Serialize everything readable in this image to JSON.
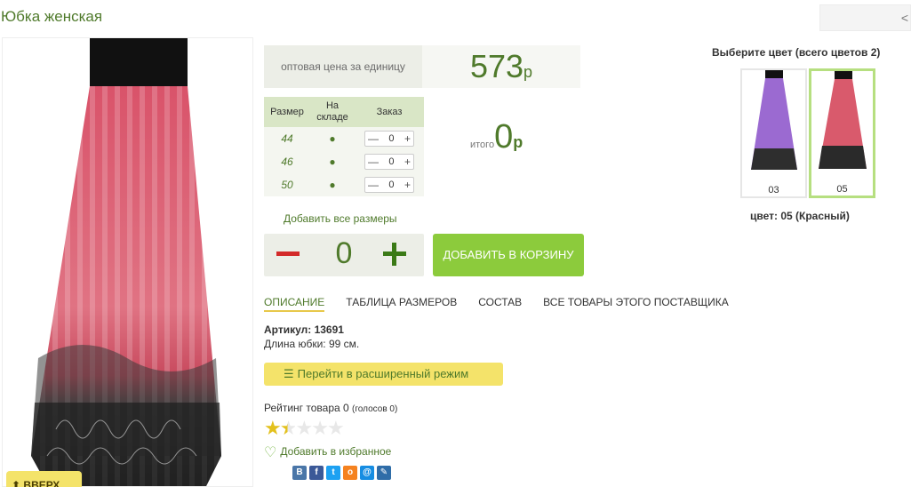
{
  "product": {
    "title": "Юбка женская",
    "up_button": "ВВЕРХ"
  },
  "nav": {
    "arrow": "<"
  },
  "price": {
    "label": "оптовая цена за единицу",
    "value": "573",
    "currency": "р"
  },
  "size_table": {
    "headers": [
      "Размер",
      "На складе",
      "Заказ"
    ],
    "rows": [
      {
        "size": "44",
        "stock": "●",
        "qty": "0"
      },
      {
        "size": "46",
        "stock": "●",
        "qty": "0"
      },
      {
        "size": "50",
        "stock": "●",
        "qty": "0"
      }
    ],
    "minus": "—",
    "plus": "+"
  },
  "total": {
    "label": "итого",
    "value": "0",
    "currency": "р"
  },
  "add_all_sizes": "Добавить все размеры",
  "big_stepper": {
    "value": "0"
  },
  "cart_button": "ДОБАВИТЬ В КОРЗИНУ",
  "tabs": [
    {
      "label": "ОПИСАНИЕ",
      "active": true
    },
    {
      "label": "ТАБЛИЦА РАЗМЕРОВ",
      "active": false
    },
    {
      "label": "СОСТАВ",
      "active": false
    },
    {
      "label": "ВСЕ ТОВАРЫ ЭТОГО ПОСТАВЩИКА",
      "active": false
    }
  ],
  "description": {
    "article": "Артикул: 13691",
    "length": "Длина юбки: 99 см."
  },
  "advanced_mode_button": "Перейти в расширенный режим",
  "rating": {
    "label": "Рейтинг товара 0",
    "votes": "(голосов 0)",
    "stars": 1.5,
    "max": 5
  },
  "favorite": "Добавить в избранное",
  "social": [
    {
      "name": "vk-icon",
      "glyph": "В",
      "color": "#4a76a8"
    },
    {
      "name": "facebook-icon",
      "glyph": "f",
      "color": "#3b5998"
    },
    {
      "name": "twitter-icon",
      "glyph": "t",
      "color": "#1da1f2"
    },
    {
      "name": "odnoklassniki-icon",
      "glyph": "о",
      "color": "#f58220"
    },
    {
      "name": "mail-icon",
      "glyph": "@",
      "color": "#168de2"
    },
    {
      "name": "livejournal-icon",
      "glyph": "✎",
      "color": "#2f6da8"
    }
  ],
  "colors": {
    "title": "Выберите цвет (всего цветов 2)",
    "options": [
      {
        "code": "03",
        "selected": false,
        "tint": "#8c63c0"
      },
      {
        "code": "05",
        "selected": true,
        "tint": "#d85a6d"
      }
    ],
    "selected_label": "цвет: 05 (Красный)"
  }
}
